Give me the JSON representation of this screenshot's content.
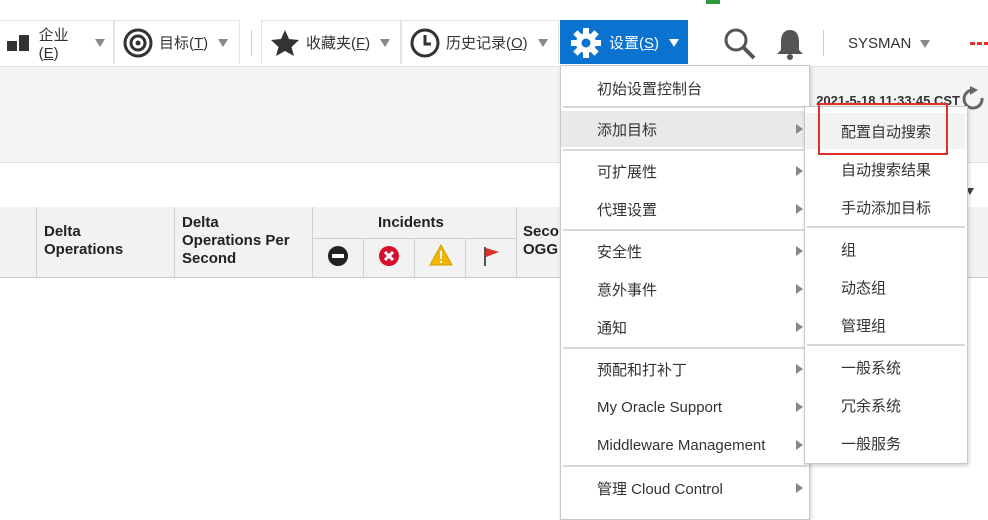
{
  "toolbar": {
    "enterprise_label": "企业(",
    "enterprise_key": "E",
    "enterprise_close": ")",
    "targets_label": "目标(",
    "targets_key": "T",
    "targets_close": ")",
    "favorites_label": "收藏夹(",
    "favorites_key": "F",
    "favorites_close": ")",
    "history_label": "历史记录(",
    "history_key": "O",
    "history_close": ")",
    "settings_label": "设置(",
    "settings_key": "S",
    "settings_close": ")",
    "user": "SYSMAN",
    "accent_color": "#0a73cf"
  },
  "page": {
    "timestamp": "2021-5-18 11:33:45 CST"
  },
  "table": {
    "col_delta_ops_1": "Delta",
    "col_delta_ops_2": "Operations",
    "col_delta_ops_ps_1": "Delta",
    "col_delta_ops_ps_2": "Operations Per",
    "col_delta_ops_ps_3": "Second",
    "col_incidents": "Incidents",
    "col_partial_1": "Seco",
    "col_partial_2": "OGG"
  },
  "menu": {
    "items": [
      {
        "label": "初始设置控制台",
        "arrow": false
      },
      {
        "label": "添加目标",
        "arrow": true
      },
      {
        "label": "可扩展性",
        "arrow": true
      },
      {
        "label": "代理设置",
        "arrow": true
      },
      {
        "label": "安全性",
        "arrow": true
      },
      {
        "label": "意外事件",
        "arrow": true
      },
      {
        "label": "通知",
        "arrow": true
      },
      {
        "label": "预配和打补丁",
        "arrow": true
      },
      {
        "label": "My Oracle Support",
        "arrow": true
      },
      {
        "label": "Middleware Management",
        "arrow": true
      },
      {
        "label": "管理 Cloud Control",
        "arrow": true
      }
    ]
  },
  "submenu": {
    "items": [
      {
        "label": "配置自动搜索"
      },
      {
        "label": "自动搜索结果"
      },
      {
        "label": "手动添加目标"
      },
      {
        "label": "组"
      },
      {
        "label": "动态组"
      },
      {
        "label": "管理组"
      },
      {
        "label": "一般系统"
      },
      {
        "label": "冗余系统"
      },
      {
        "label": "一般服务"
      }
    ]
  }
}
